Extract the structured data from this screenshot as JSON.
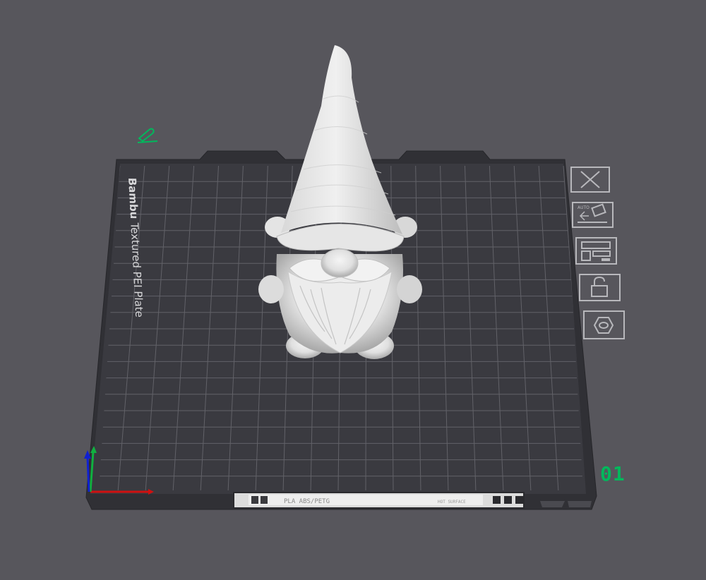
{
  "plate": {
    "brand_label": "Bambu",
    "plate_label": "Textured PEI Plate",
    "plate_number": "01",
    "sticker_material_text": "PLA ABS/PETG",
    "sticker_right_text": "HOT SURFACE"
  },
  "toolbar": {
    "buttons": [
      {
        "name": "delete-plate",
        "icon": "close-icon"
      },
      {
        "name": "auto-orient",
        "icon": "auto-orient-icon",
        "badge": "AUTO"
      },
      {
        "name": "arrange",
        "icon": "arrange-icon"
      },
      {
        "name": "lock-plate",
        "icon": "lock-icon"
      },
      {
        "name": "plate-settings",
        "icon": "settings-hex-icon"
      }
    ]
  },
  "colors": {
    "background": "#57565c",
    "plate": "#38383d",
    "grid": "#65656b",
    "plate_number": "#00b85c",
    "axis_x": "#d01010",
    "axis_y": "#10b040",
    "axis_z": "#1020d0"
  },
  "model": {
    "name": "gnome"
  }
}
